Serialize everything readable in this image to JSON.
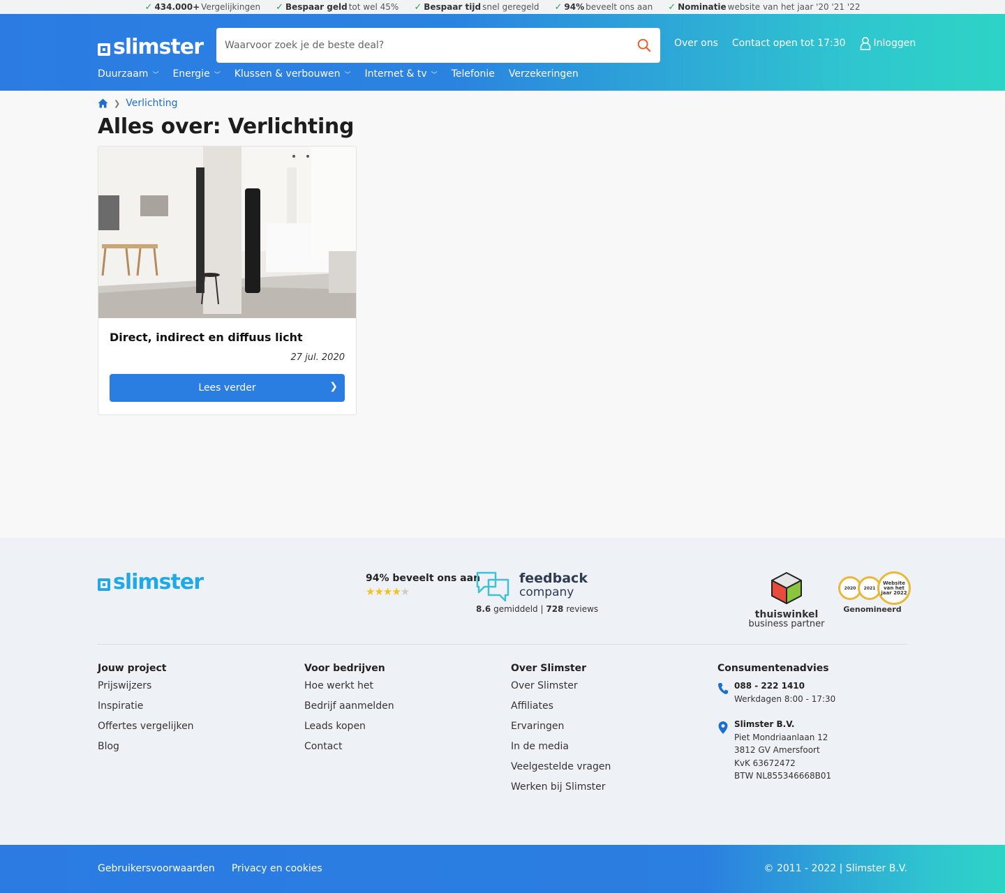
{
  "usps": [
    {
      "bold": "434.000+",
      "text": " Vergelijkingen"
    },
    {
      "bold": "Bespaar geld",
      "text": " tot wel 45%"
    },
    {
      "bold": "Bespaar tijd",
      "text": " snel geregeld"
    },
    {
      "bold": "94%",
      "text": " beveelt ons aan"
    },
    {
      "bold": "Nominatie",
      "text": " website van het jaar '20 '21 '22"
    }
  ],
  "header": {
    "logo": "slimster",
    "search_placeholder": "Waarvoor zoek je de beste deal?",
    "links": {
      "about": "Over ons",
      "contact": "Contact open tot 17:30",
      "login": "Inloggen"
    },
    "nav": [
      {
        "label": "Duurzaam",
        "has_dropdown": true
      },
      {
        "label": "Energie",
        "has_dropdown": true
      },
      {
        "label": "Klussen & verbouwen",
        "has_dropdown": true
      },
      {
        "label": "Internet & tv",
        "has_dropdown": true
      },
      {
        "label": "Telefonie",
        "has_dropdown": false
      },
      {
        "label": "Verzekeringen",
        "has_dropdown": false
      }
    ]
  },
  "breadcrumb": {
    "current": "Verlichting"
  },
  "page_title": "Alles over: Verlichting",
  "article": {
    "title": "Direct, indirect en diffuus licht",
    "date": "27 jul. 2020",
    "button": "Lees verder"
  },
  "footer": {
    "logo": "slimster",
    "rating_text": "94% beveelt ons aan",
    "stars": 4,
    "feedback": {
      "line1": "feedback",
      "line2": "company",
      "score": "8.6",
      "score_suffix": " gemiddeld | ",
      "reviews": "728",
      "reviews_suffix": " reviews"
    },
    "thuiswinkel": {
      "line1": "thuiswinkel",
      "line2": "business partner"
    },
    "award": {
      "years": [
        "2020",
        "2021"
      ],
      "big": "Website van het jaar 2022",
      "label": "Genomineerd"
    },
    "columns": [
      {
        "heading": "Jouw project",
        "links": [
          "Prijswijzers",
          "Inspiratie",
          "Offertes vergelijken",
          "Blog"
        ]
      },
      {
        "heading": "Voor bedrijven",
        "links": [
          "Hoe werkt het",
          "Bedrijf aanmelden",
          "Leads kopen",
          "Contact"
        ]
      },
      {
        "heading": "Over Slimster",
        "links": [
          "Over Slimster",
          "Affiliates",
          "Ervaringen",
          "In de media",
          "Veelgestelde vragen",
          "Werken bij Slimster"
        ]
      }
    ],
    "consumer": {
      "heading": "Consumentenadvies",
      "phone": "088 - 222 1410",
      "hours": "Werkdagen 8:00 - 17:30",
      "company": "Slimster B.V.",
      "address": [
        "Piet Mondriaanlaan 12",
        "3812 GV Amersfoort",
        "KvK 63672472",
        "BTW NL855346668B01"
      ]
    }
  },
  "bottom": {
    "terms": "Gebruikersvoorwaarden",
    "privacy": "Privacy en cookies",
    "copyright": "© 2011 - 2022 | Slimster B.V."
  },
  "colors": {
    "brand_blue": "#2b7be3",
    "brand_teal": "#2dd4c5",
    "search_icon": "#e8622a",
    "check": "#2aa346"
  }
}
